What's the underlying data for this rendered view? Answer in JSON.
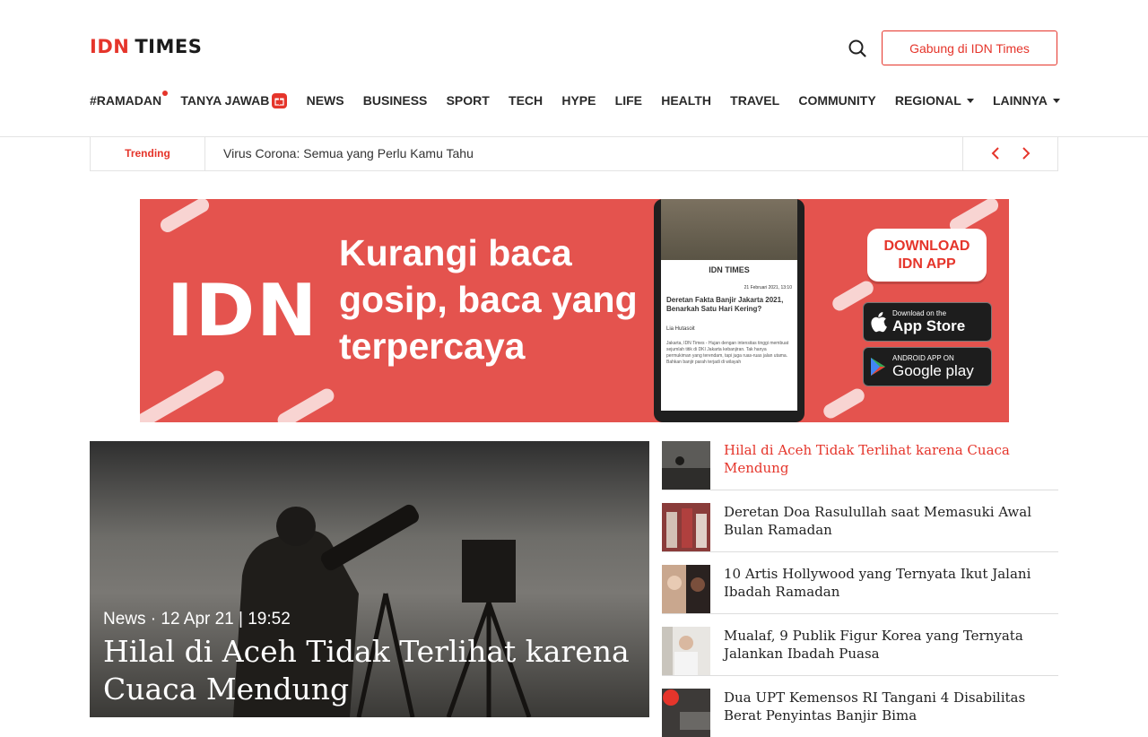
{
  "header": {
    "logo_main": "IDN",
    "logo_sub": "TIMES",
    "join_label": "Gabung di IDN Times"
  },
  "nav": {
    "items": [
      {
        "label": "#RAMADAN"
      },
      {
        "label": "TANYA JAWAB"
      },
      {
        "label": "NEWS"
      },
      {
        "label": "BUSINESS"
      },
      {
        "label": "SPORT"
      },
      {
        "label": "TECH"
      },
      {
        "label": "HYPE"
      },
      {
        "label": "LIFE"
      },
      {
        "label": "HEALTH"
      },
      {
        "label": "TRAVEL"
      },
      {
        "label": "COMMUNITY"
      },
      {
        "label": "REGIONAL"
      },
      {
        "label": "LAINNYA"
      }
    ]
  },
  "trending": {
    "label": "Trending",
    "text": "Virus Corona: Semua yang Perlu Kamu Tahu"
  },
  "banner": {
    "logo": "IDN",
    "headline": "Kurangi baca gosip, baca yang terpercaya",
    "download_label": "DOWNLOAD IDN APP",
    "appstore_small": "Download on the",
    "appstore_big": "App Store",
    "play_small": "ANDROID APP ON",
    "play_big": "Google play",
    "phone_logo": "IDN TIMES",
    "phone_date": "21 Februari 2021, 13:10",
    "phone_title": "Deretan Fakta Banjir Jakarta 2021, Benarkah Satu Hari Kering?",
    "phone_author": "Lia Hutasoit",
    "phone_body": "Jakarta, IDN Times - Hujan dengan intensitas tinggi membuat sejumlah titik di DKI Jakarta kebanjiran. Tak hanya permukiman yang terendam, tapi juga ruas-ruas jalan utama. Bahkan banjir parah terjadi di wilayah"
  },
  "hero": {
    "category": "News",
    "datetime": "12 Apr 21 | 19:52",
    "title": "Hilal di Aceh Tidak Terlihat karena Cuaca Mendung"
  },
  "side_list": [
    {
      "title": "Hilal di Aceh Tidak Terlihat karena Cuaca Mendung",
      "active": true
    },
    {
      "title": "Deretan Doa Rasulullah saat Memasuki Awal Bulan Ramadan",
      "active": false
    },
    {
      "title": "10 Artis Hollywood yang Ternyata Ikut Jalani Ibadah Ramadan",
      "active": false
    },
    {
      "title": "Mualaf, 9 Publik Figur Korea yang Ternyata Jalankan Ibadah Puasa",
      "active": false
    },
    {
      "title": "Dua UPT Kemensos RI Tangani 4 Disabilitas Berat Penyintas Banjir Bima",
      "active": false
    }
  ],
  "colors": {
    "brand_red": "#e5352b",
    "banner_red": "#e4534e",
    "text_dark": "#222222"
  }
}
